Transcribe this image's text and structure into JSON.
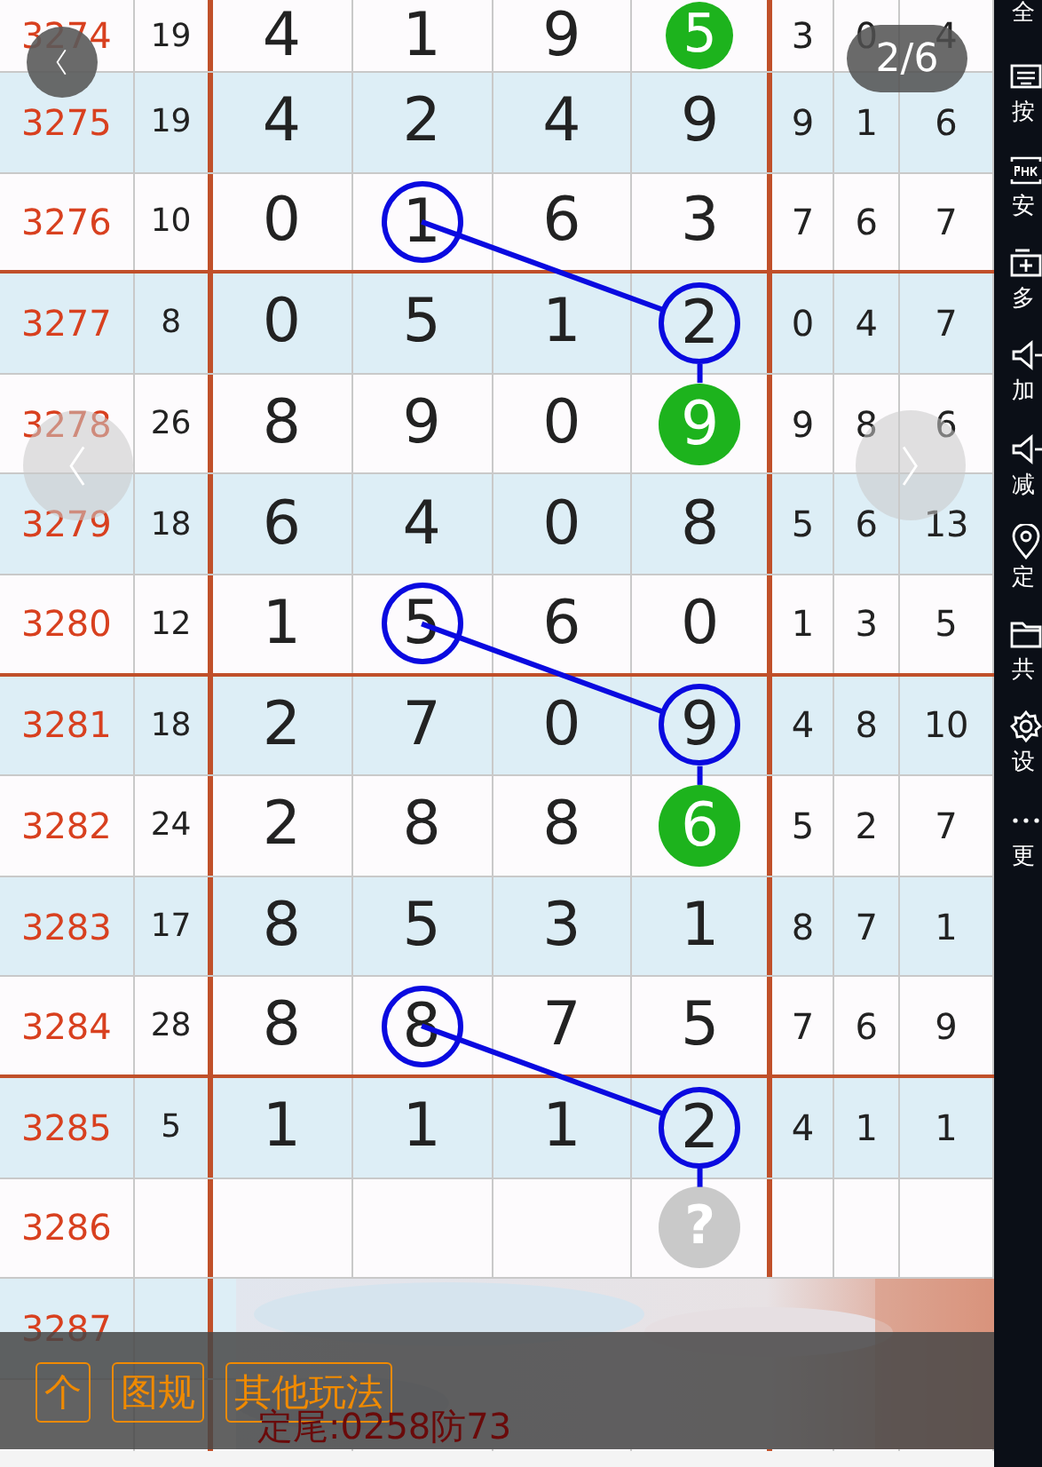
{
  "table": {
    "rows": [
      {
        "id": "3274",
        "sum": "19",
        "digits": [
          {
            "v": "4"
          },
          {
            "v": "1"
          },
          {
            "v": "9"
          },
          {
            "v": "5",
            "kind": "ball"
          }
        ],
        "tail": [
          "3",
          "0",
          "4"
        ],
        "group_end": false
      },
      {
        "id": "3275",
        "sum": "19",
        "digits": [
          {
            "v": "4"
          },
          {
            "v": "2"
          },
          {
            "v": "4"
          },
          {
            "v": "9",
            "kind": "plain"
          }
        ],
        "tail": [
          "9",
          "1",
          "6"
        ],
        "group_end": false
      },
      {
        "id": "3276",
        "sum": "10",
        "digits": [
          {
            "v": "0"
          },
          {
            "v": "1",
            "kind": "ring"
          },
          {
            "v": "6"
          },
          {
            "v": "3"
          }
        ],
        "tail": [
          "7",
          "6",
          "7"
        ],
        "group_end": true
      },
      {
        "id": "3277",
        "sum": "8",
        "digits": [
          {
            "v": "0"
          },
          {
            "v": "5"
          },
          {
            "v": "1"
          },
          {
            "v": "2",
            "kind": "ring"
          }
        ],
        "tail": [
          "0",
          "4",
          "7"
        ],
        "group_end": false
      },
      {
        "id": "3278",
        "sum": "26",
        "digits": [
          {
            "v": "8"
          },
          {
            "v": "9"
          },
          {
            "v": "0"
          },
          {
            "v": "9",
            "kind": "ball"
          }
        ],
        "tail": [
          "9",
          "8",
          "6"
        ],
        "group_end": false
      },
      {
        "id": "3279",
        "sum": "18",
        "digits": [
          {
            "v": "6"
          },
          {
            "v": "4"
          },
          {
            "v": "0"
          },
          {
            "v": "8"
          }
        ],
        "tail": [
          "5",
          "6",
          "13"
        ],
        "group_end": false
      },
      {
        "id": "3280",
        "sum": "12",
        "digits": [
          {
            "v": "1"
          },
          {
            "v": "5",
            "kind": "ring"
          },
          {
            "v": "6"
          },
          {
            "v": "0"
          }
        ],
        "tail": [
          "1",
          "3",
          "5"
        ],
        "group_end": true
      },
      {
        "id": "3281",
        "sum": "18",
        "digits": [
          {
            "v": "2"
          },
          {
            "v": "7"
          },
          {
            "v": "0"
          },
          {
            "v": "9",
            "kind": "ring"
          }
        ],
        "tail": [
          "4",
          "8",
          "10"
        ],
        "group_end": false
      },
      {
        "id": "3282",
        "sum": "24",
        "digits": [
          {
            "v": "2"
          },
          {
            "v": "8"
          },
          {
            "v": "8"
          },
          {
            "v": "6",
            "kind": "ball"
          }
        ],
        "tail": [
          "5",
          "2",
          "7"
        ],
        "group_end": false
      },
      {
        "id": "3283",
        "sum": "17",
        "digits": [
          {
            "v": "8"
          },
          {
            "v": "5"
          },
          {
            "v": "3"
          },
          {
            "v": "1"
          }
        ],
        "tail": [
          "8",
          "7",
          "1"
        ],
        "group_end": false
      },
      {
        "id": "3284",
        "sum": "28",
        "digits": [
          {
            "v": "8"
          },
          {
            "v": "8",
            "kind": "ring"
          },
          {
            "v": "7"
          },
          {
            "v": "5"
          }
        ],
        "tail": [
          "7",
          "6",
          "9"
        ],
        "group_end": true
      },
      {
        "id": "3285",
        "sum": "5",
        "digits": [
          {
            "v": "1"
          },
          {
            "v": "1"
          },
          {
            "v": "1"
          },
          {
            "v": "2",
            "kind": "ring"
          }
        ],
        "tail": [
          "4",
          "1",
          "1"
        ],
        "group_end": false
      },
      {
        "id": "3286",
        "prediction": "?",
        "group_end": false
      },
      {
        "id": "3287",
        "group_end": false
      }
    ]
  },
  "viewer": {
    "counter": "2/6"
  },
  "bottom_bar": {
    "buttons": [
      "个",
      "图规",
      "其他玩法"
    ],
    "caption": "定尾:0258防73"
  },
  "sidebar": {
    "items": [
      {
        "label": "全",
        "kind": "none"
      },
      {
        "label": "按",
        "kind": "keyboard"
      },
      {
        "label": "安",
        "kind": "apk"
      },
      {
        "label": "多",
        "kind": "plus"
      },
      {
        "label": "加",
        "kind": "speaker"
      },
      {
        "label": "减",
        "kind": "speaker"
      },
      {
        "label": "定",
        "kind": "pin"
      },
      {
        "label": "共",
        "kind": "folder"
      },
      {
        "label": "设",
        "kind": "gear"
      },
      {
        "label": "更",
        "kind": "dots"
      }
    ]
  }
}
